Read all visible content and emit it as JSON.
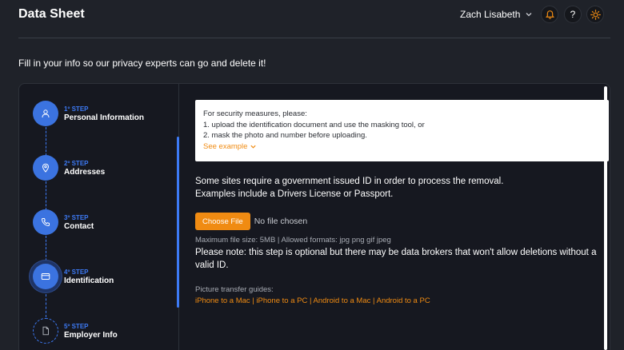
{
  "header": {
    "title": "Data Sheet",
    "user_name": "Zach Lisabeth",
    "icons": {
      "notifications": "bell-icon",
      "help": "help-icon",
      "theme": "sun-icon"
    },
    "help_glyph": "?"
  },
  "intro": "Fill in your info so our privacy experts can go and delete it!",
  "steps": [
    {
      "num": "1º STEP",
      "label": "Personal Information",
      "icon": "user-icon",
      "state": "done"
    },
    {
      "num": "2º STEP",
      "label": "Addresses",
      "icon": "map-pin-icon",
      "state": "done"
    },
    {
      "num": "3º STEP",
      "label": "Contact",
      "icon": "phone-icon",
      "state": "done"
    },
    {
      "num": "4º STEP",
      "label": "Identification",
      "icon": "id-card-icon",
      "state": "active"
    },
    {
      "num": "5º STEP",
      "label": "Employer Info",
      "icon": "document-icon",
      "state": "pending"
    }
  ],
  "notice": {
    "line1": "For security measures, please:",
    "line2": "1. upload the identification document and use the masking tool, or",
    "line3": "2. mask the photo and number before uploading.",
    "see_example": "See example"
  },
  "description": {
    "line1": "Some sites require a government issued ID in order to process the removal.",
    "line2": "Examples include a Drivers License or Passport."
  },
  "upload": {
    "button_label": "Choose File",
    "status": "No file chosen",
    "meta": "Maximum file size: 5MB | Allowed formats: jpg png gif jpeg"
  },
  "note": "Please note: this step is optional but there may be data brokers that won't allow deletions without a valid ID.",
  "guides": {
    "label": "Picture transfer guides:",
    "separator": "|",
    "links": [
      "iPhone to a Mac",
      "iPhone to a PC",
      "Android to a Mac",
      "Android to a PC"
    ]
  },
  "colors": {
    "background": "#1f2229",
    "card": "#161820",
    "accent_blue": "#3b73e0",
    "accent_orange": "#f08b12"
  }
}
